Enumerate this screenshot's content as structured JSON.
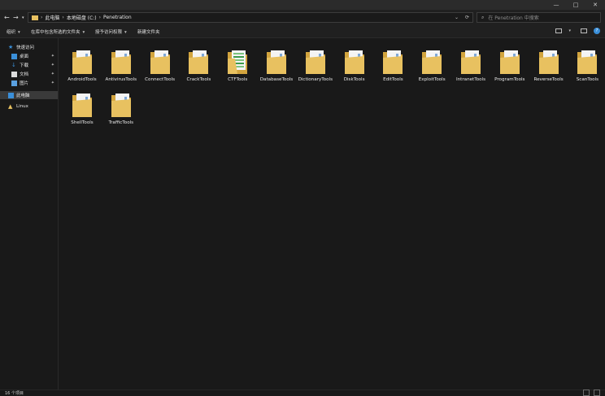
{
  "window": {
    "controls": [
      "—",
      "□",
      "✕"
    ]
  },
  "address": {
    "crumbs": [
      "此电脑",
      "本地磁盘 (C:)",
      "Penetration"
    ],
    "dropdown_icon": "chevron-down-icon",
    "refresh_icon": "refresh-icon"
  },
  "search": {
    "placeholder": "在 Penetration 中搜索"
  },
  "commands": {
    "organize": "组织",
    "include_library": "在库中包含所选的文件夹",
    "share": "授予访问权限",
    "new_folder": "新建文件夹"
  },
  "sidebar": {
    "quick_access": "快速访问",
    "desktop": "桌面",
    "downloads": "下载",
    "documents": "文档",
    "pictures": "图片",
    "this_pc": "此电脑",
    "linux": "Linux"
  },
  "folders": [
    "AndroidTools",
    "AntivirusTools",
    "ConnectTools",
    "CrackTools",
    "CTFTools",
    "DatabaseTools",
    "DictionaryTools",
    "DiskTools",
    "EditTools",
    "ExploitTools",
    "IntranetTools",
    "ProgramTools",
    "ReverseTools",
    "ScanTools",
    "ShellTools",
    "TrafficTools"
  ],
  "status": {
    "item_count": "16 个项目"
  },
  "colors": {
    "folder": "#e8c160",
    "folder_dark": "#d2a43e",
    "accent": "#3a8fd9"
  }
}
